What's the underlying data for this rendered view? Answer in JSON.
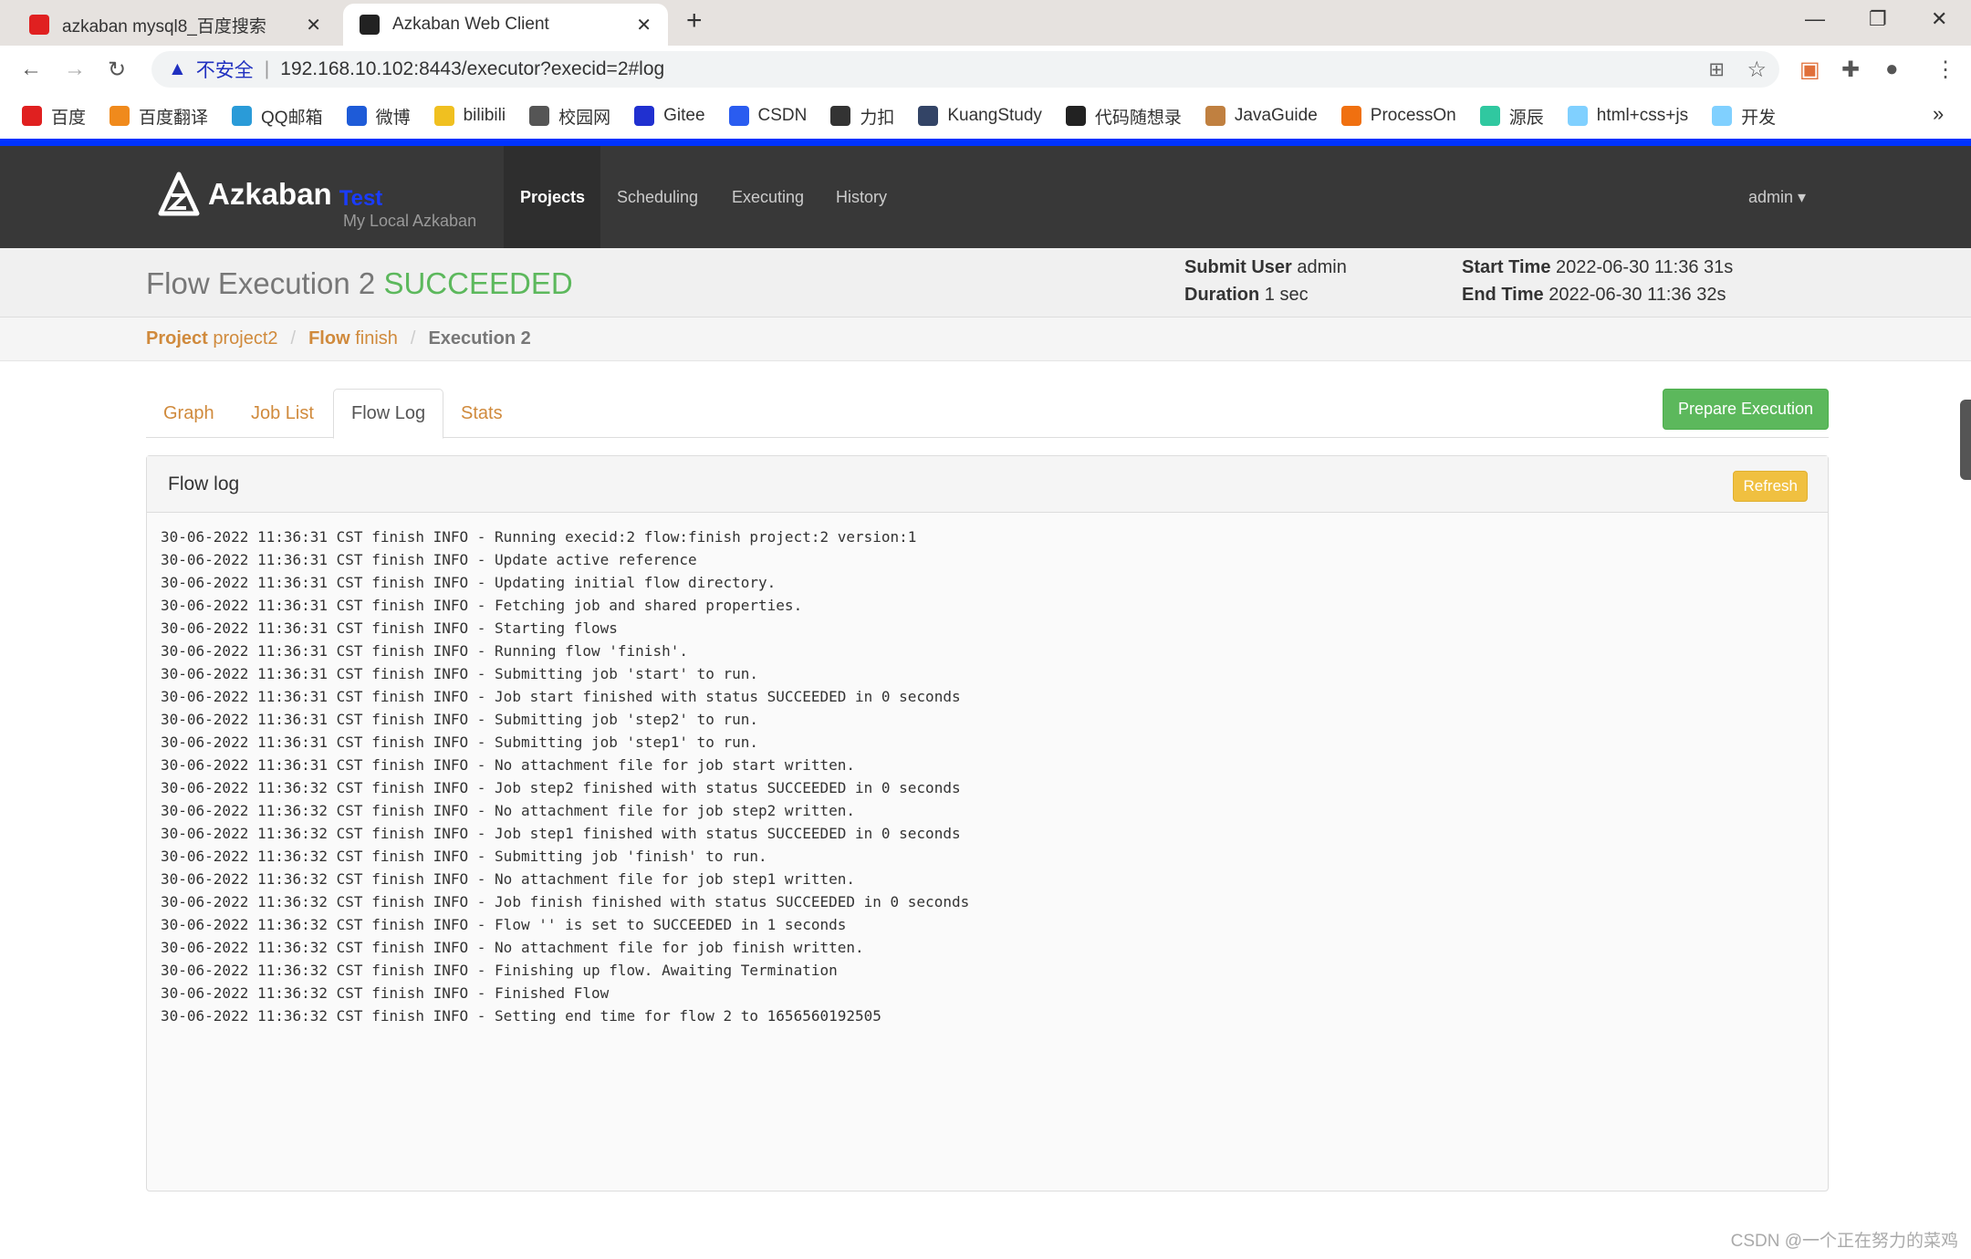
{
  "browser": {
    "tabs": [
      {
        "title": "azkaban mysql8_百度搜索",
        "close": "✕"
      },
      {
        "title": "Azkaban Web Client",
        "close": "✕"
      }
    ],
    "new_tab": "+",
    "security_label": "不安全",
    "url": "192.168.10.102:8443/executor?execid=2#log",
    "bookmarks": [
      {
        "label": "百度",
        "color": "#e02020"
      },
      {
        "label": "百度翻译",
        "color": "#f08a1c"
      },
      {
        "label": "QQ邮箱",
        "color": "#2a9bd8"
      },
      {
        "label": "微博",
        "color": "#1e5bd8"
      },
      {
        "label": "bilibili",
        "color": "#f0c020"
      },
      {
        "label": "校园网",
        "color": "#555555"
      },
      {
        "label": "Gitee",
        "color": "#2030d0"
      },
      {
        "label": "CSDN",
        "color": "#2a5cf0"
      },
      {
        "label": "力扣",
        "color": "#333333"
      },
      {
        "label": "KuangStudy",
        "color": "#334466"
      },
      {
        "label": "代码随想录",
        "color": "#222222"
      },
      {
        "label": "JavaGuide",
        "color": "#c08040"
      },
      {
        "label": "ProcessOn",
        "color": "#f07010"
      },
      {
        "label": "源辰",
        "color": "#30c8a0"
      },
      {
        "label": "html+css+js",
        "color": "#80d0ff"
      },
      {
        "label": "开发",
        "color": "#80d0ff"
      }
    ],
    "more": "»"
  },
  "nav": {
    "brand": "Azkaban",
    "env": "Test",
    "subtitle": "My Local Azkaban",
    "links": [
      "Projects",
      "Scheduling",
      "Executing",
      "History"
    ],
    "active": "Projects",
    "user": "admin ▾"
  },
  "header": {
    "title": "Flow Execution 2",
    "status": "SUCCEEDED",
    "status_color": "#5cb85c",
    "submit_user_label": "Submit User",
    "submit_user": "admin",
    "duration_label": "Duration",
    "duration": "1 sec",
    "start_label": "Start Time",
    "start": "2022-06-30 11:36 31s",
    "end_label": "End Time",
    "end": "2022-06-30 11:36 32s"
  },
  "breadcrumb": {
    "project_label": "Project",
    "project": "project2",
    "flow_label": "Flow",
    "flow": "finish",
    "execution": "Execution 2",
    "sep": "/"
  },
  "tabs": [
    "Graph",
    "Job List",
    "Flow Log",
    "Stats"
  ],
  "active_tab": "Flow Log",
  "prepare_button": "Prepare Execution",
  "panel": {
    "title": "Flow log",
    "refresh": "Refresh",
    "lines": [
      "30-06-2022 11:36:31 CST finish INFO - Running execid:2 flow:finish project:2 version:1",
      "30-06-2022 11:36:31 CST finish INFO - Update active reference",
      "30-06-2022 11:36:31 CST finish INFO - Updating initial flow directory.",
      "30-06-2022 11:36:31 CST finish INFO - Fetching job and shared properties.",
      "30-06-2022 11:36:31 CST finish INFO - Starting flows",
      "30-06-2022 11:36:31 CST finish INFO - Running flow 'finish'.",
      "30-06-2022 11:36:31 CST finish INFO - Submitting job 'start' to run.",
      "30-06-2022 11:36:31 CST finish INFO - Job start finished with status SUCCEEDED in 0 seconds",
      "30-06-2022 11:36:31 CST finish INFO - Submitting job 'step2' to run.",
      "30-06-2022 11:36:31 CST finish INFO - Submitting job 'step1' to run.",
      "30-06-2022 11:36:31 CST finish INFO - No attachment file for job start written.",
      "30-06-2022 11:36:32 CST finish INFO - Job step2 finished with status SUCCEEDED in 0 seconds",
      "30-06-2022 11:36:32 CST finish INFO - No attachment file for job step2 written.",
      "30-06-2022 11:36:32 CST finish INFO - Job step1 finished with status SUCCEEDED in 0 seconds",
      "30-06-2022 11:36:32 CST finish INFO - Submitting job 'finish' to run.",
      "30-06-2022 11:36:32 CST finish INFO - No attachment file for job step1 written.",
      "30-06-2022 11:36:32 CST finish INFO - Job finish finished with status SUCCEEDED in 0 seconds",
      "30-06-2022 11:36:32 CST finish INFO - Flow '' is set to SUCCEEDED in 1 seconds",
      "30-06-2022 11:36:32 CST finish INFO - No attachment file for job finish written.",
      "30-06-2022 11:36:32 CST finish INFO - Finishing up flow. Awaiting Termination",
      "30-06-2022 11:36:32 CST finish INFO - Finished Flow",
      "30-06-2022 11:36:32 CST finish INFO - Setting end time for flow 2 to 1656560192505"
    ]
  },
  "watermark": "CSDN @一个正在努力的菜鸡"
}
